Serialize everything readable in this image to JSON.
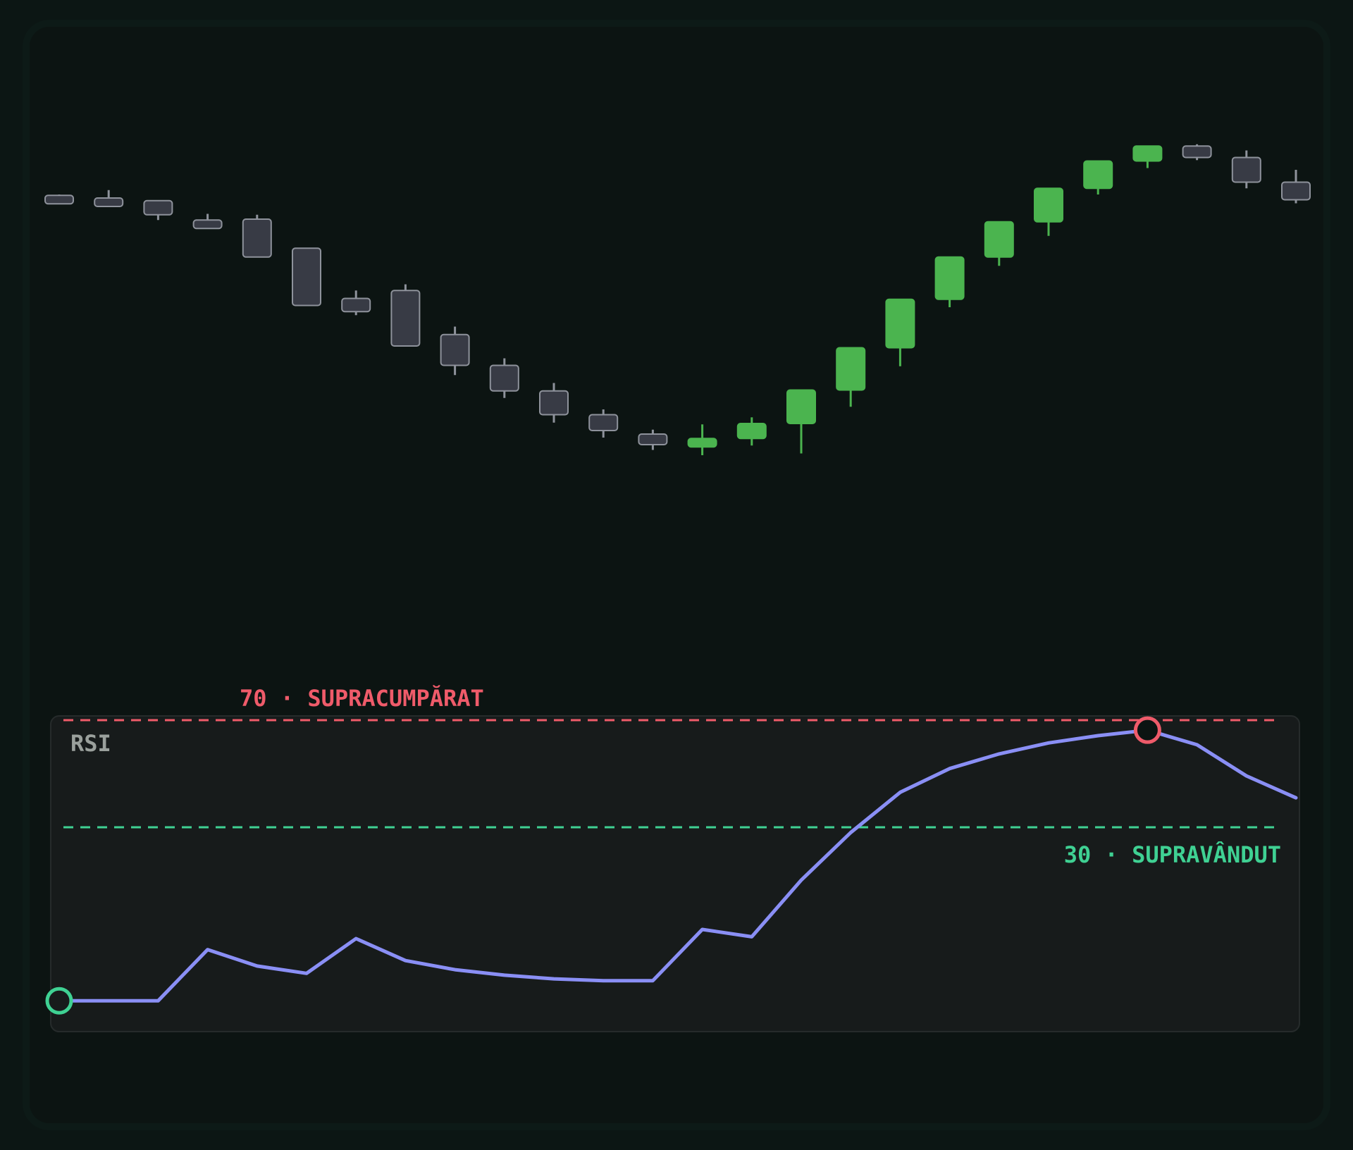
{
  "colors": {
    "page_bg": "#0c1614",
    "frame_bg": "#0c1412",
    "panel_bg": "#171b1b",
    "panel_border": "#262b2b",
    "up": "#4bb44f",
    "down_fill": "#383b45",
    "down_stroke": "#8e929b",
    "rsi_line": "#8a8ff5",
    "overbought": "#ef5b6a",
    "oversold": "#3fd193",
    "rsi_label": "#9aa09c"
  },
  "chart_data": [
    {
      "type": "candlestick",
      "series": [
        {
          "name": "",
          "ohlc": [
            [
              25.5,
              26.0,
              23.0,
              24.0
            ],
            [
              24.0,
              28.5,
              19.5,
              22.5
            ],
            [
              22.5,
              17.0,
              14.5,
              11.5
            ],
            [
              11.5,
              15.0,
              10.0,
              12.0
            ],
            [
              12.0,
              14.5,
              -9.5,
              -4.5
            ],
            [
              -4.5,
              -4.5,
              -37.0,
              -33.0
            ],
            [
              -33.0,
              -28.5,
              -40.5,
              -42.5
            ],
            [
              -28.5,
              -25.0,
              -60.0,
              -53.5
            ],
            [
              -53.5,
              -49.0,
              -71.0,
              -76.5
            ],
            [
              -71.0,
              -67.0,
              -85.5,
              -89.5
            ],
            [
              -85.5,
              -81.0,
              -99.0,
              -103.5
            ],
            [
              -99.0,
              -96.0,
              -108.0,
              -112.0
            ],
            [
              -110.0,
              -107.5,
              -116.0,
              -119.0
            ],
            [
              -116.0,
              -104.5,
              -112.5,
              -122.0
            ],
            [
              -112.5,
              -100.5,
              -104.0,
              -116.5
            ],
            [
              -104.0,
              -98.0,
              -85.0,
              -121.0
            ],
            [
              -85.0,
              -81.5,
              -61.0,
              -94.5
            ],
            [
              -61.0,
              -50.5,
              -33.5,
              -71.5
            ],
            [
              -33.5,
              -26.0,
              -9.5,
              -38.0
            ],
            [
              -9.5,
              6.5,
              10.5,
              -14.5
            ],
            [
              10.5,
              17.5,
              29.5,
              2.5
            ],
            [
              29.5,
              35.0,
              45.0,
              26.0
            ],
            [
              45.0,
              52.5,
              53.5,
              41.0
            ],
            [
              53.5,
              54.5,
              47.0,
              45.5
            ],
            [
              47.0,
              51.0,
              33.0,
              29.5
            ],
            [
              33.0,
              40.0,
              23.0,
              21.0
            ]
          ]
        }
      ]
    },
    {
      "type": "line",
      "title": "RSI",
      "ylim": [
        0,
        100
      ],
      "x": [
        1,
        2,
        3,
        4,
        5,
        6,
        7,
        8,
        9,
        10,
        11,
        12,
        13,
        14,
        15,
        16,
        17,
        18,
        19,
        20,
        21,
        22,
        23,
        24,
        25,
        26
      ],
      "series": [
        {
          "name": "",
          "values": [
            4,
            4,
            4,
            18,
            13.5,
            11.5,
            21,
            15,
            12.5,
            11,
            10,
            9.5,
            9.5,
            23.5,
            21.5,
            37,
            50,
            61,
            67.5,
            71.5,
            74.5,
            76.5,
            78,
            74,
            65.5,
            59.5
          ]
        }
      ],
      "annotations": {
        "overbought": {
          "value": 70,
          "label": "70 · SUPRACUMPĂRAT"
        },
        "oversold": {
          "value": 30,
          "label": "30 · SUPRAVÂNDUT"
        }
      }
    }
  ]
}
